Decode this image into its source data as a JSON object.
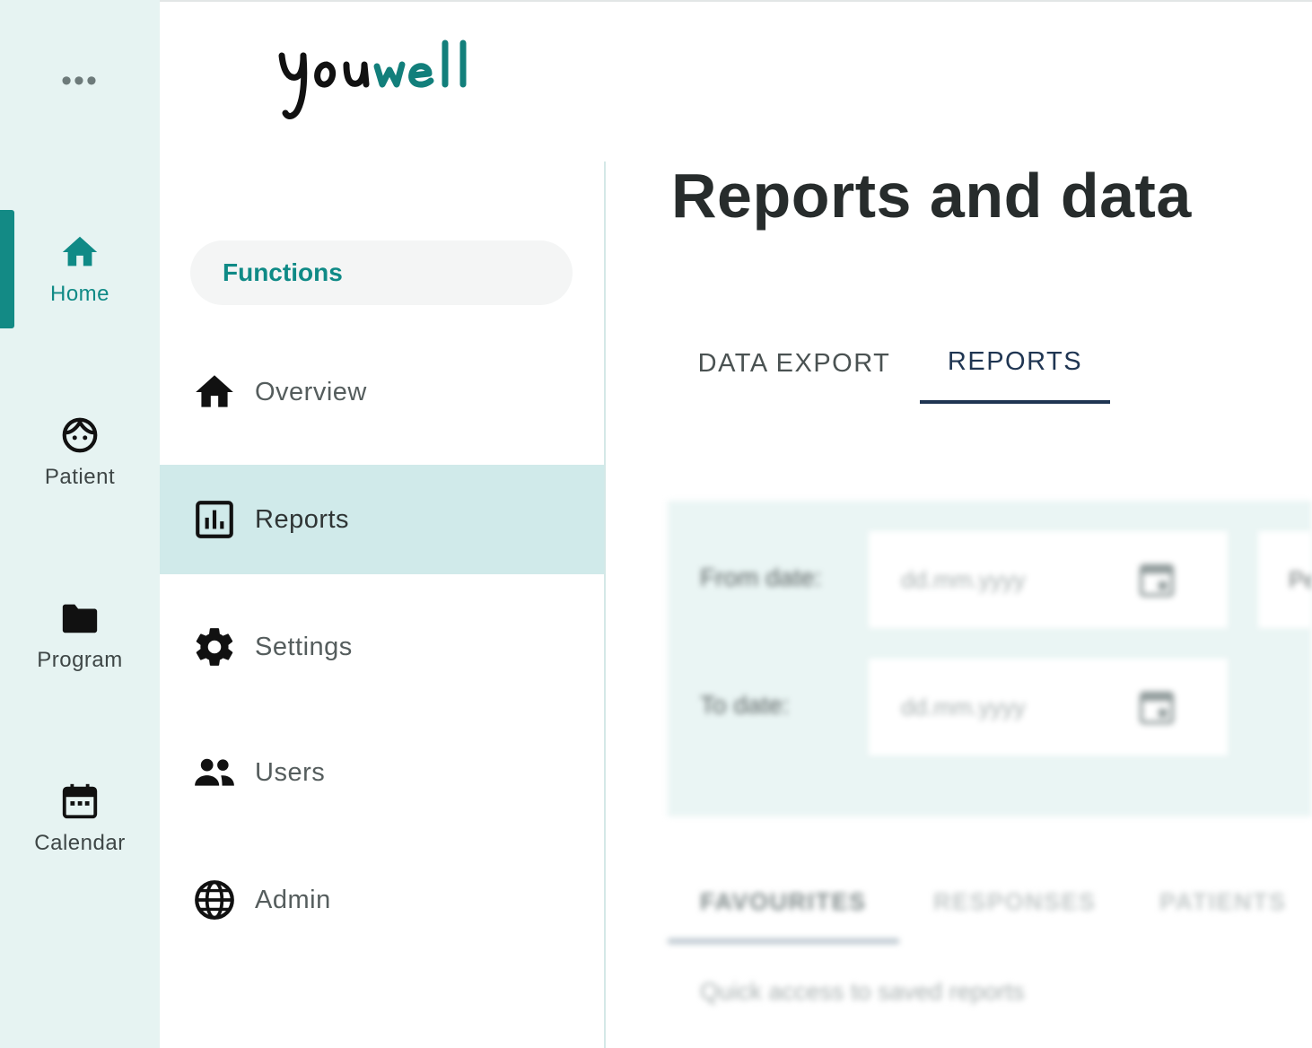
{
  "rail": {
    "more": "•••",
    "items": [
      {
        "label": "Home",
        "icon": "home-icon",
        "active": true
      },
      {
        "label": "Patient",
        "icon": "patient-face-icon",
        "active": false
      },
      {
        "label": "Program",
        "icon": "folder-icon",
        "active": false
      },
      {
        "label": "Calendar",
        "icon": "calendar-icon",
        "active": false
      }
    ]
  },
  "brand": {
    "logo_text": "youwell",
    "logo_color_dark": "#111111",
    "logo_color_accent": "#127f7b"
  },
  "sidebar": {
    "section": "Functions",
    "items": [
      {
        "label": "Overview",
        "icon": "home-icon",
        "active": false
      },
      {
        "label": "Reports",
        "icon": "bar-chart-icon",
        "active": true
      },
      {
        "label": "Settings",
        "icon": "gear-icon",
        "active": false
      },
      {
        "label": "Users",
        "icon": "users-icon",
        "active": false
      },
      {
        "label": "Admin",
        "icon": "globe-icon",
        "active": false
      }
    ]
  },
  "main": {
    "title": "Reports and data",
    "tabs": [
      {
        "label": "DATA EXPORT",
        "active": false
      },
      {
        "label": "REPORTS",
        "active": true
      }
    ],
    "filters": {
      "from_label": "From date:",
      "from_placeholder": "dd.mm.yyyy",
      "to_label": "To date:",
      "to_placeholder": "dd.mm.yyyy",
      "third_label": "Pe"
    },
    "subtabs": [
      {
        "label": "FAVOURITES",
        "active": true
      },
      {
        "label": "RESPONSES",
        "active": false
      },
      {
        "label": "PATIENTS",
        "active": false
      }
    ],
    "hint": "Quick access to saved reports"
  },
  "colors": {
    "accent": "#138a85",
    "rail_bg": "#e6f3f2",
    "active_nav_bg": "#d0eaea",
    "tab_active": "#1f3552"
  }
}
